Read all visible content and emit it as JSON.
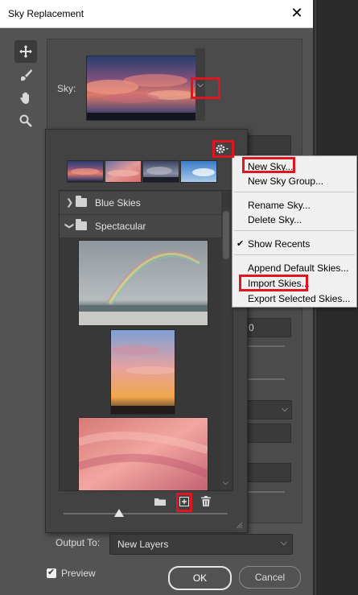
{
  "window": {
    "title": "Sky Replacement"
  },
  "sky": {
    "label": "Sky:"
  },
  "library": {
    "folders": [
      {
        "name": "Blue Skies",
        "expanded": false
      },
      {
        "name": "Spectacular",
        "expanded": true
      }
    ]
  },
  "menu": {
    "items": [
      {
        "label": "New Sky...",
        "highlighted": true
      },
      {
        "label": "New Sky Group..."
      },
      {
        "label": "Rename Sky..."
      },
      {
        "label": "Delete Sky..."
      },
      {
        "label": "Show Recents",
        "checked": true
      },
      {
        "label": "Append Default Skies..."
      },
      {
        "label": "Import Skies...",
        "highlighted": true
      },
      {
        "label": "Export Selected Skies..."
      }
    ]
  },
  "fields": {
    "value_0": "0"
  },
  "output": {
    "label": "Output To:",
    "value": "New Layers"
  },
  "preview": {
    "label": "Preview",
    "checked": true
  },
  "buttons": {
    "ok": "OK",
    "cancel": "Cancel"
  },
  "colors": {
    "highlight": "#e0151f",
    "dialog_bg": "#535353",
    "menu_bg": "#f0f0f0"
  }
}
